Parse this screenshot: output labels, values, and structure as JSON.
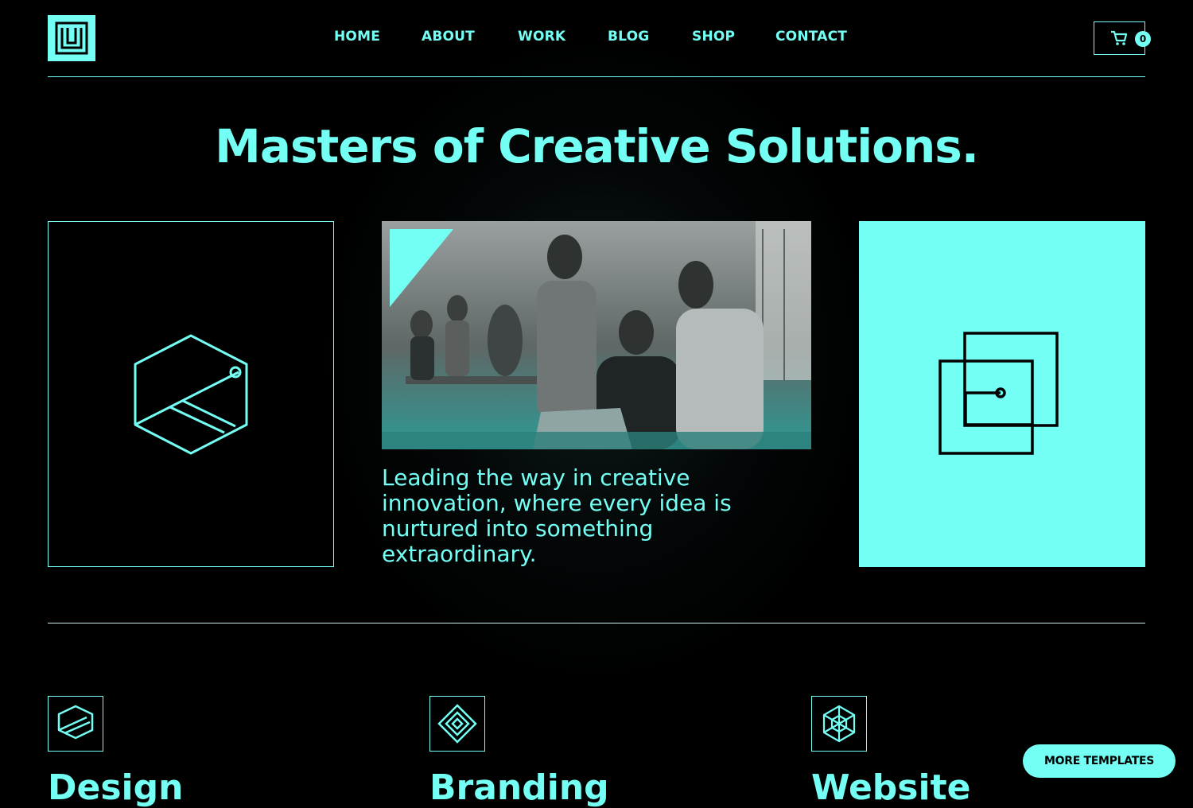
{
  "brand": {
    "logo_icon": "brand-logo-icon",
    "accent": "#74fff4"
  },
  "nav": {
    "items": [
      {
        "label": "HOME"
      },
      {
        "label": "ABOUT"
      },
      {
        "label": "WORK"
      },
      {
        "label": "BLOG"
      },
      {
        "label": "SHOP"
      },
      {
        "label": "CONTACT"
      }
    ]
  },
  "cart": {
    "icon": "cart-icon",
    "count": "0"
  },
  "hero": {
    "title": "Masters of Creative Solutions.",
    "description": "Leading the way in creative innovation, where every idea is nurtured into something extraordinary.",
    "left_card_icon": "hexagon-icon",
    "right_card_icon": "overlapping-squares-icon",
    "photo_alt": "team-meeting-photo"
  },
  "services": [
    {
      "title": "Design",
      "icon": "layers-icon"
    },
    {
      "title": "Branding",
      "icon": "diamond-icon"
    },
    {
      "title": "Website",
      "icon": "snowflake-icon"
    }
  ],
  "more_templates": {
    "label": "MORE TEMPLATES"
  }
}
